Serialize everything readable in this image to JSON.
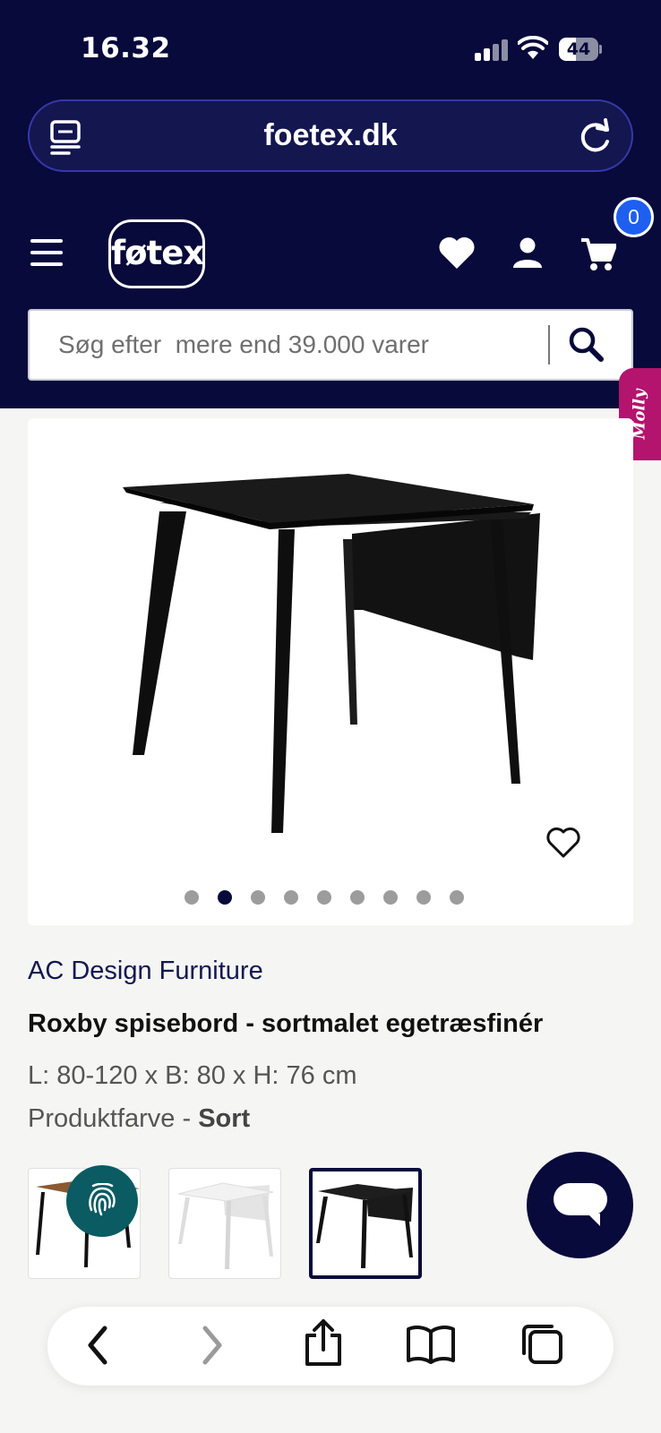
{
  "status_bar": {
    "time": "16.32",
    "battery": "44",
    "battery_level": 0.44
  },
  "browser": {
    "url": "foetex.dk"
  },
  "header": {
    "logo": "føtex",
    "cart_count": "0",
    "search_placeholder": "Søg efter  mere end 39.000 varer"
  },
  "side_tab": {
    "label": "Molly"
  },
  "gallery": {
    "image_count": 9,
    "active_index": 1
  },
  "product": {
    "brand": "AC Design Furniture",
    "title": "Roxby spisebord - sortmalet egetræsfinér",
    "dimensions": "L: 80-120 x B: 80 x H: 76 cm",
    "color_label": "Produktfarve - ",
    "color_value": "Sort",
    "variants": [
      "walnut",
      "white",
      "black"
    ],
    "selected_variant": "black"
  },
  "colors": {
    "navy": "#070a3a",
    "accent_blue": "#1e5ff0",
    "molly_pink": "#b4136e",
    "fingerprint_teal": "#0b5b63"
  }
}
